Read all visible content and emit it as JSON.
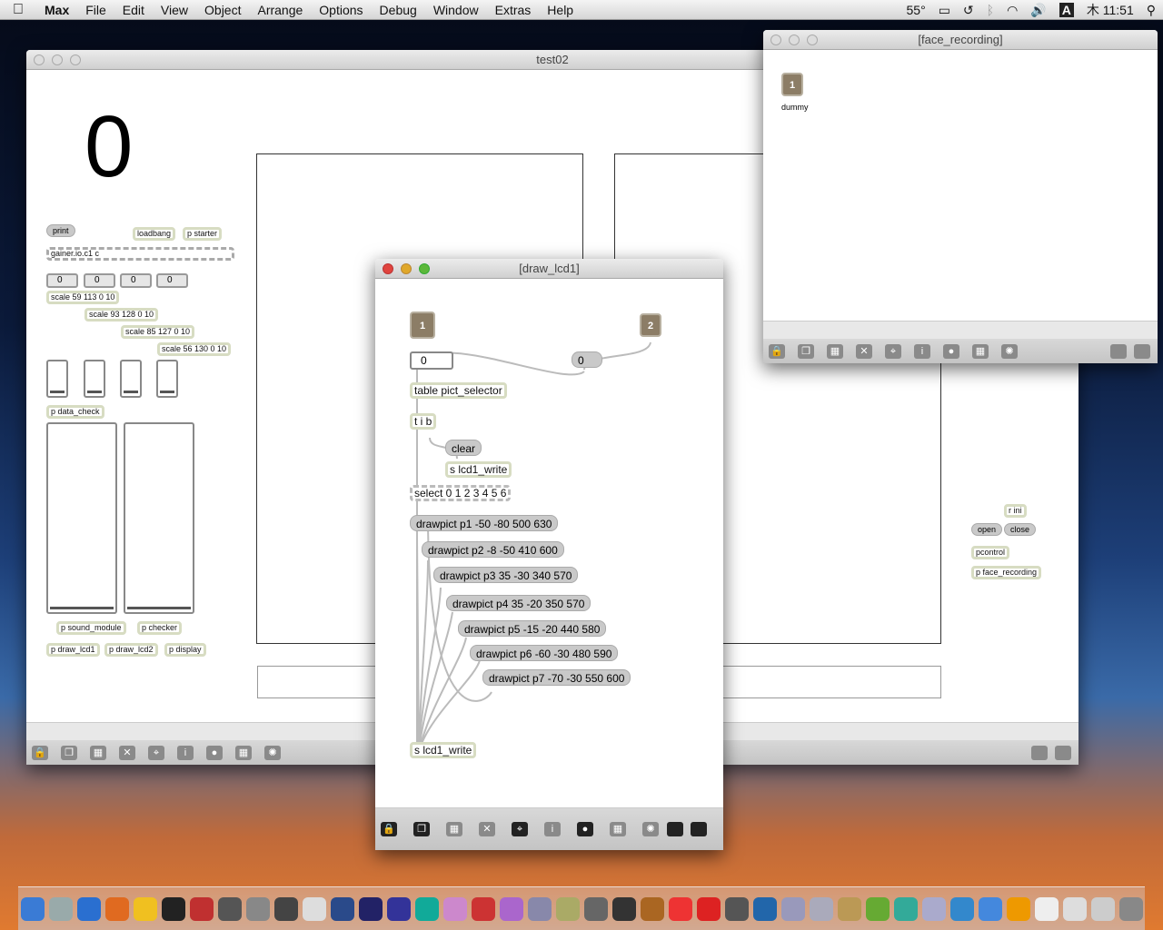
{
  "menubar": {
    "app": "Max",
    "items": [
      "File",
      "Edit",
      "View",
      "Object",
      "Arrange",
      "Options",
      "Debug",
      "Window",
      "Extras",
      "Help"
    ],
    "temp": "55°",
    "clock": "木 11:51",
    "input": "A"
  },
  "test02": {
    "title": "test02",
    "big_number": "0",
    "objects": {
      "print": "print",
      "loadbang": "loadbang",
      "starter": "p starter",
      "gainer": "gainer.io.c1 c",
      "n1": "0",
      "n2": "0",
      "n3": "0",
      "n4": "0",
      "scale1": "scale 59 113 0 10",
      "scale2": "scale 93 128 0 10",
      "scale3": "scale 85 127 0 10",
      "scale4": "scale 56 130 0 10",
      "data_check": "p data_check",
      "sound_module": "p sound_module",
      "checker": "p checker",
      "draw_lcd1": "p draw_lcd1",
      "draw_lcd2": "p draw_lcd2",
      "display": "p display",
      "r_ini": "r ini",
      "open": "open",
      "close": "close",
      "pcontrol": "pcontrol",
      "face_recording": "p face_recording"
    }
  },
  "face_recording": {
    "title": "[face_recording]",
    "inlet": "1",
    "inlet_label": "dummy"
  },
  "draw_lcd1": {
    "title": "[draw_lcd1]",
    "inlet1": "1",
    "inlet2": "2",
    "numbox": "0",
    "msg0": "0",
    "table": "table pict_selector",
    "tib": "t i b",
    "clear": "clear",
    "s_write_top": "s lcd1_write",
    "select": "select 0 1 2 3 4 5 6",
    "drawpicts": [
      "drawpict p1 -50 -80 500 630",
      "drawpict p2 -8 -50 410 600",
      "drawpict p3 35 -30 340 570",
      "drawpict p4 35 -20 350 570",
      "drawpict p5 -15 -20 440 580",
      "drawpict p6 -60 -30 480 590",
      "drawpict p7 -70 -30 550 600"
    ],
    "s_write": "s lcd1_write"
  },
  "toolbar": {
    "icons": [
      "lock-icon",
      "copy-icon",
      "palette-icon",
      "delete-icon",
      "presentation-icon",
      "info-icon",
      "connect-icon",
      "grid-icon",
      "debug-icon"
    ],
    "glyphs": [
      "🔒",
      "❐",
      "▦",
      "✕",
      "⌖",
      "i",
      "●",
      "▦",
      "✺"
    ]
  },
  "dock": {
    "colors": [
      "#3a7bd5",
      "#9aa",
      "#2a6fd0",
      "#e06a20",
      "#f0c020",
      "#222",
      "#c03030",
      "#555",
      "#888",
      "#444",
      "#ddd",
      "#2a4a8a",
      "#226",
      "#339",
      "#1a9",
      "#c8c",
      "#c33",
      "#a6c",
      "#88a",
      "#aa6",
      "#666",
      "#333",
      "#a62",
      "#e33",
      "#d22",
      "#555",
      "#26a",
      "#99b",
      "#aab",
      "#b95",
      "#6a3",
      "#3a9",
      "#aac",
      "#38c",
      "#48d",
      "#e90",
      "#eee",
      "#ddd",
      "#ccc",
      "#888"
    ]
  }
}
